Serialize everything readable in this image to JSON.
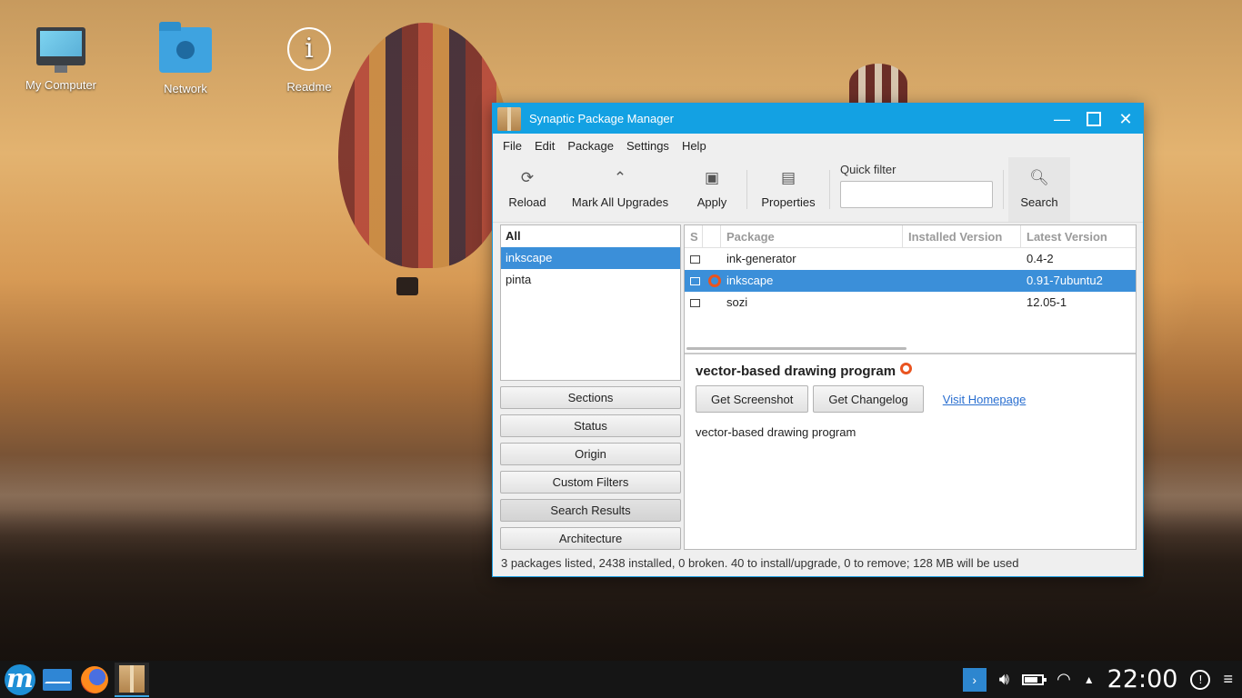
{
  "desktop": {
    "icons": [
      {
        "label": "My Computer",
        "icon": "computer-icon"
      },
      {
        "label": "Network",
        "icon": "network-folder-icon"
      },
      {
        "label": "Readme",
        "icon": "info-icon"
      }
    ]
  },
  "window": {
    "title": "Synaptic Package Manager",
    "accent": "#13a1e3",
    "controls": {
      "minimize": "—",
      "maximize": "",
      "close": "✕"
    }
  },
  "menu": [
    "File",
    "Edit",
    "Package",
    "Settings",
    "Help"
  ],
  "toolbar": {
    "reload": "Reload",
    "mark_all_upgrades": "Mark All Upgrades",
    "apply": "Apply",
    "properties": "Properties",
    "quick_filter_label": "Quick filter",
    "quick_filter_value": "",
    "search": "Search"
  },
  "filters": {
    "items": [
      "All",
      "inkscape",
      "pinta"
    ],
    "selected": "inkscape"
  },
  "category_buttons": [
    "Sections",
    "Status",
    "Origin",
    "Custom Filters",
    "Search Results",
    "Architecture"
  ],
  "package_table": {
    "columns": [
      "S",
      "",
      "Package",
      "Installed Version",
      "Latest Version"
    ],
    "rows": [
      {
        "package": "ink-generator",
        "installed": "",
        "latest": "0.4-2",
        "selected": false
      },
      {
        "package": "inkscape",
        "installed": "",
        "latest": "0.91-7ubuntu2",
        "selected": true
      },
      {
        "package": "sozi",
        "installed": "",
        "latest": "12.05-1",
        "selected": false
      }
    ]
  },
  "details": {
    "title": "vector-based drawing program",
    "get_screenshot": "Get Screenshot",
    "get_changelog": "Get Changelog",
    "visit_homepage": "Visit Homepage",
    "description": "vector-based drawing program"
  },
  "status_bar": "3 packages listed, 2438 installed, 0 broken. 40 to install/upgrade, 0 to remove; 128 MB will be used",
  "taskbar": {
    "clock": "22:00",
    "tray_arrow": "›"
  }
}
